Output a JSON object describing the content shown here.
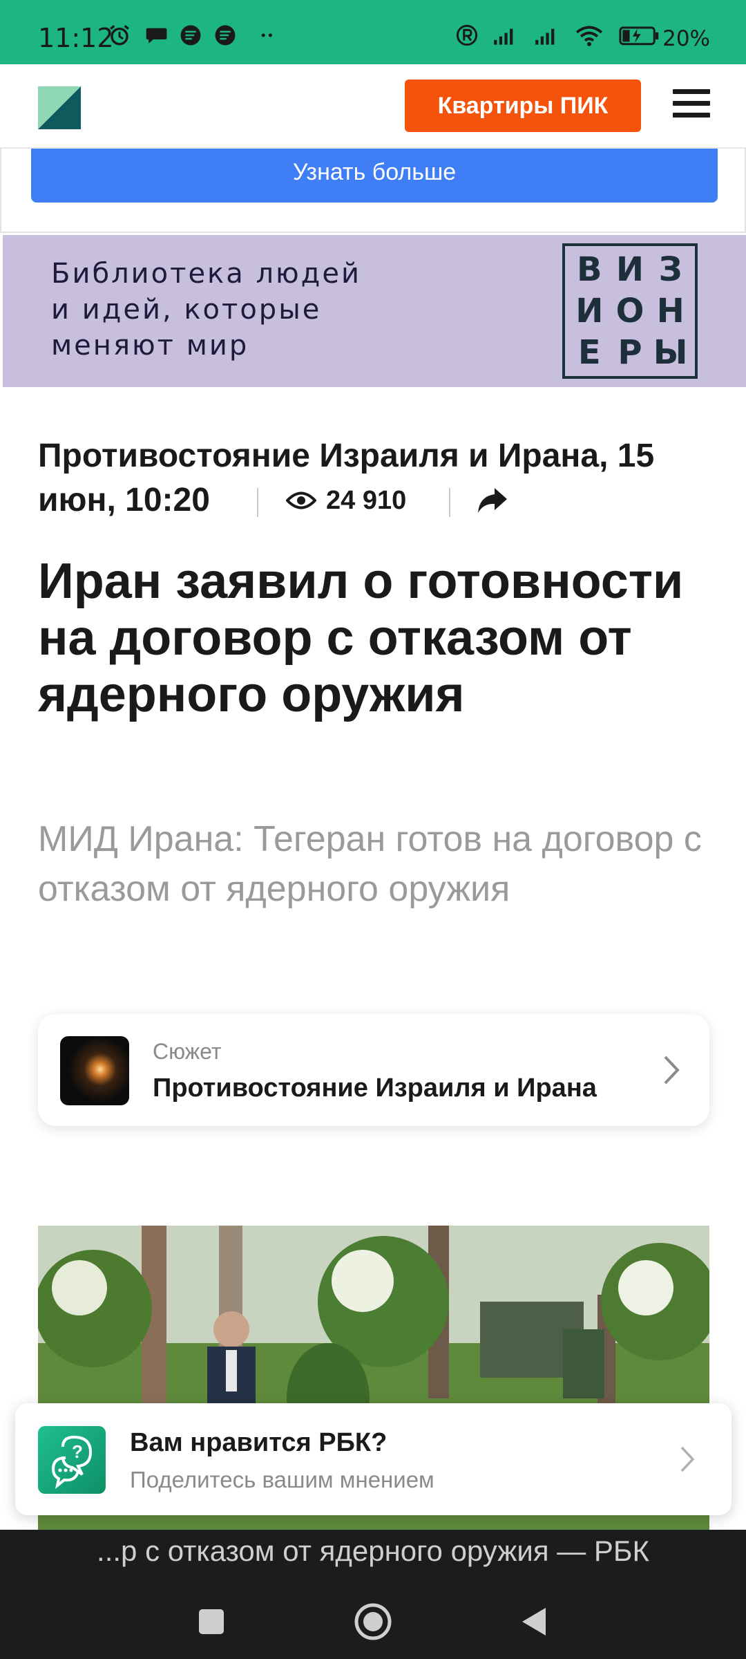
{
  "status_bar": {
    "time": "11:12",
    "battery_percent": "20%",
    "background": "#1db683"
  },
  "header": {
    "logo_icon": "rbc-logo-icon",
    "cta_label": "Квартиры ПИК",
    "menu_icon": "hamburger-menu-icon",
    "cta_color": "#f5530c"
  },
  "ad": {
    "learn_more_label": "Узнать больше",
    "banner": {
      "lines": [
        "Библиотека людей",
        "и идей, которые",
        "меняют мир"
      ],
      "logo_letters": [
        "В",
        "И",
        "З",
        "И",
        "О",
        "Н",
        "Е",
        "Р",
        "Ы"
      ],
      "background": "#c8bfdf"
    }
  },
  "article": {
    "meta_line": "Противостояние Израиля и Ирана, 15 июн, 10:20",
    "views": "24 910",
    "headline": "Иран заявил о готовности на договор с отказом от ядерного оружия",
    "subtitle": "МИД Ирана: Тегеран готов на договор с отказом от ядерного оружия"
  },
  "story_card": {
    "label": "Сюжет",
    "title": "Противостояние Израиля и Ирана"
  },
  "feedback": {
    "title": "Вам нравится РБК?",
    "subtitle": "Поделитесь вашим мнением"
  },
  "url_bar": {
    "text": "...р с отказом от ядерного оружия — РБК"
  }
}
